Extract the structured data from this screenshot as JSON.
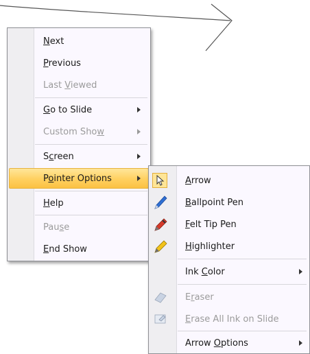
{
  "context_menu": {
    "items": [
      {
        "pre": "",
        "acc": "N",
        "post": "ext",
        "disabled": false
      },
      {
        "pre": "",
        "acc": "P",
        "post": "revious",
        "disabled": false
      },
      {
        "pre": "Last ",
        "acc": "V",
        "post": "iewed",
        "disabled": true
      },
      {
        "pre": "",
        "acc": "G",
        "post": "o to Slide",
        "disabled": false
      },
      {
        "pre": "Custom Sho",
        "acc": "w",
        "post": "",
        "disabled": true
      },
      {
        "pre": "S",
        "acc": "c",
        "post": "reen",
        "disabled": false
      },
      {
        "pre": "P",
        "acc": "o",
        "post": "inter Options",
        "disabled": false
      },
      {
        "pre": "",
        "acc": "H",
        "post": "elp",
        "disabled": false
      },
      {
        "pre": "Pau",
        "acc": "s",
        "post": "e",
        "disabled": true
      },
      {
        "pre": "",
        "acc": "E",
        "post": "nd Show",
        "disabled": false
      }
    ]
  },
  "pointer_options_submenu": {
    "items": [
      {
        "pre": "",
        "acc": "A",
        "post": "rrow",
        "disabled": false,
        "icon": "arrow-pointer-icon"
      },
      {
        "pre": "",
        "acc": "B",
        "post": "allpoint Pen",
        "disabled": false,
        "icon": "ballpoint-pen-icon"
      },
      {
        "pre": "",
        "acc": "F",
        "post": "elt Tip Pen",
        "disabled": false,
        "icon": "felt-tip-pen-icon"
      },
      {
        "pre": "",
        "acc": "H",
        "post": "ighlighter",
        "disabled": false,
        "icon": "highlighter-icon"
      },
      {
        "pre": "Ink ",
        "acc": "C",
        "post": "olor",
        "disabled": false,
        "icon": ""
      },
      {
        "pre": "E",
        "acc": "r",
        "post": "aser",
        "disabled": true,
        "icon": "eraser-icon"
      },
      {
        "pre": "",
        "acc": "E",
        "post": "rase All Ink on Slide",
        "disabled": true,
        "icon": "erase-all-ink-icon"
      },
      {
        "pre": "Arrow ",
        "acc": "O",
        "post": "ptions",
        "disabled": false,
        "icon": ""
      }
    ]
  },
  "colors": {
    "highlight_top": "#ffe69a",
    "highlight_bottom": "#fbc143",
    "menu_background": "#fbf8ff",
    "pen_blue": "#2f6fd3",
    "pen_red": "#d63a2a",
    "highlighter_yellow": "#f2c21a"
  }
}
